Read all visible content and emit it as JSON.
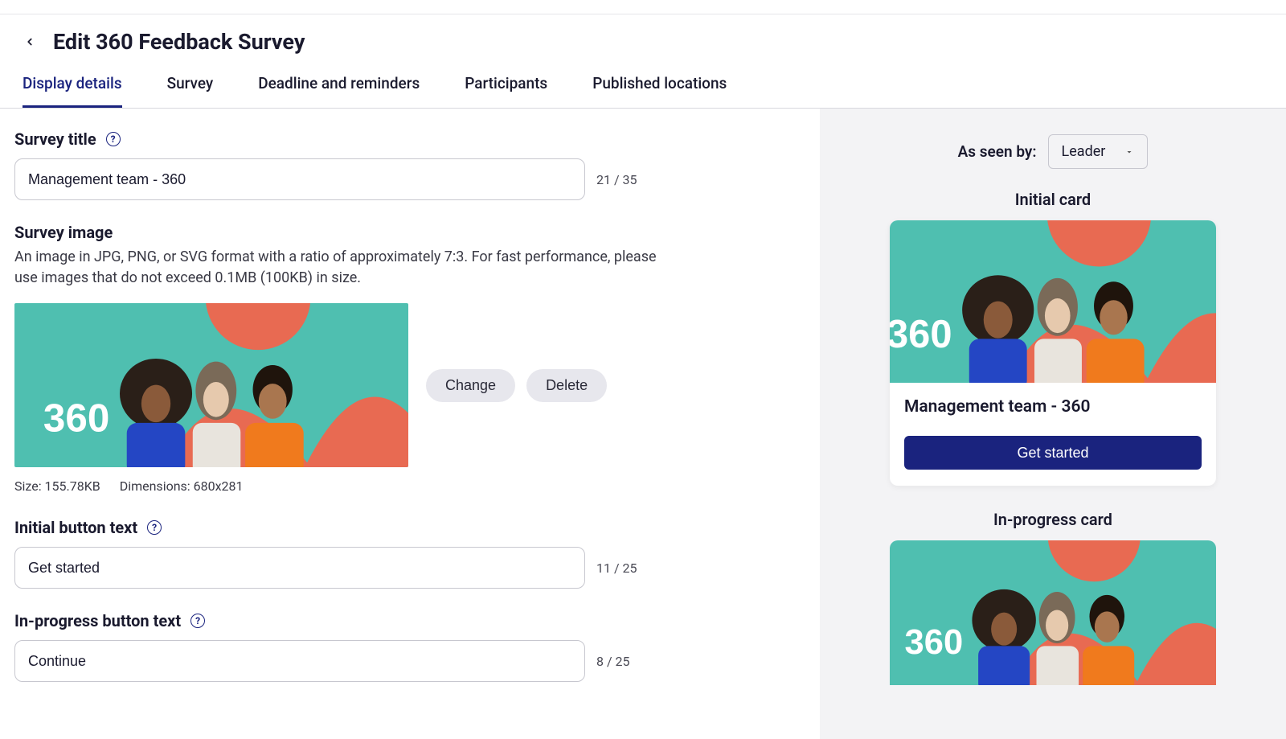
{
  "page": {
    "title": "Edit 360 Feedback Survey"
  },
  "tabs": {
    "display_details": "Display details",
    "survey": "Survey",
    "deadline": "Deadline and reminders",
    "participants": "Participants",
    "published": "Published locations"
  },
  "form": {
    "survey_title_label": "Survey title",
    "survey_title_value": "Management team - 360",
    "survey_title_counter": "21 / 35",
    "survey_image_label": "Survey image",
    "survey_image_help": "An image in JPG, PNG, or SVG format with a ratio of approximately 7:3. For fast performance, please use images that do not exceed 0.1MB (100KB) in size.",
    "change_btn": "Change",
    "delete_btn": "Delete",
    "image_size": "Size: 155.78KB",
    "image_dims": "Dimensions: 680x281",
    "initial_btn_label": "Initial button text",
    "initial_btn_value": "Get started",
    "initial_btn_counter": "11 / 25",
    "inprogress_btn_label": "In-progress button text",
    "inprogress_btn_value": "Continue",
    "inprogress_btn_counter": "8 / 25"
  },
  "preview": {
    "as_seen_label": "As seen by:",
    "as_seen_value": "Leader",
    "initial_card_heading": "Initial card",
    "initial_card_title": "Management team - 360",
    "initial_card_cta": "Get started",
    "inprogress_card_heading": "In-progress card"
  },
  "hero_image": {
    "overlay_text": "360"
  }
}
